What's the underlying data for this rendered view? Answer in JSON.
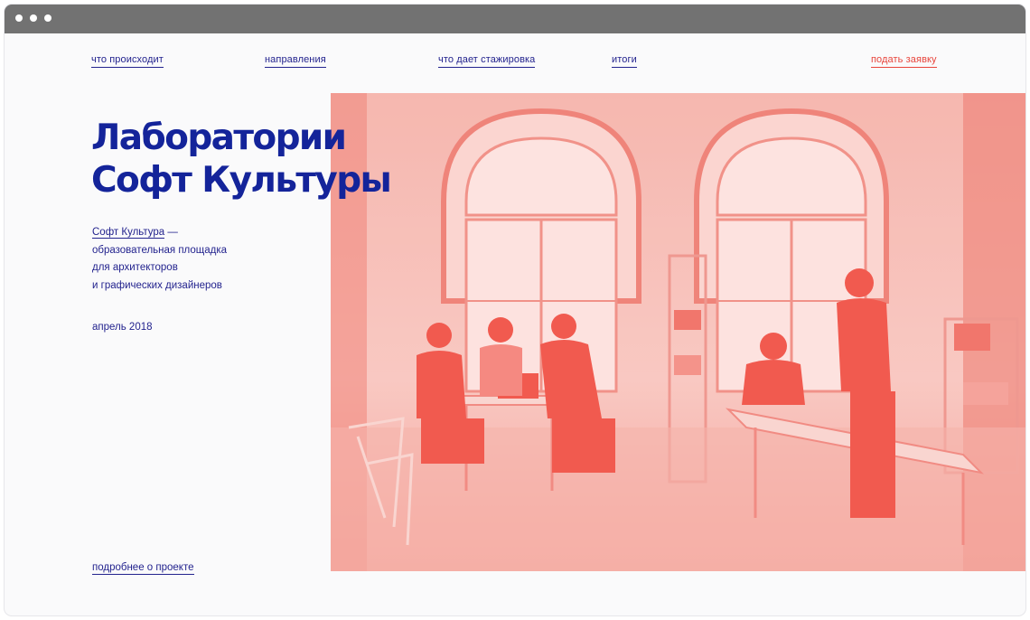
{
  "nav": {
    "items": [
      {
        "label": "что происходит"
      },
      {
        "label": "направления"
      },
      {
        "label": "что дает стажировка"
      },
      {
        "label": "итоги"
      }
    ],
    "cta_label": "подать заявку"
  },
  "hero": {
    "title_line1": "Лаборатории",
    "title_line2": "Софт Культуры",
    "desc_brand": "Софт Культура",
    "desc_dash": " —",
    "desc_line2": "образовательная площадка",
    "desc_line3": "для архитекторов",
    "desc_line4": "и графических дизайнеров",
    "date": "апрель 2018",
    "more_link": "подробнее о проекте"
  },
  "colors": {
    "accent_blue": "#14249a",
    "link_blue": "#23238e",
    "cta_red": "#e8453c",
    "photo_tint": "#f25a4f"
  },
  "icons": {
    "window_controls": [
      "dot",
      "dot",
      "dot"
    ]
  }
}
